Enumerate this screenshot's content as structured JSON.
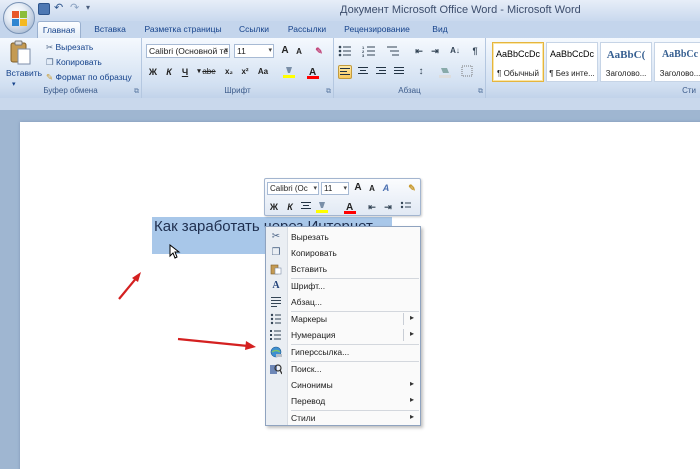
{
  "window": {
    "title": "Документ Microsoft Office Word - Microsoft Word"
  },
  "tabs": [
    "Главная",
    "Вставка",
    "Разметка страницы",
    "Ссылки",
    "Рассылки",
    "Рецензирование",
    "Вид"
  ],
  "ribbon": {
    "clipboard": {
      "paste": "Вставить",
      "cut": "Вырезать",
      "copy": "Копировать",
      "format_painter": "Формат по образцу",
      "label": "Буфер обмена"
    },
    "font": {
      "font_name": "Calibri (Основной те",
      "font_size": "11",
      "bold": "Ж",
      "italic": "К",
      "underline": "Ч",
      "strike": "abe",
      "subscript": "x₂",
      "superscript": "x²",
      "change_case": "Aa",
      "grow": "A",
      "shrink": "A",
      "label": "Шрифт"
    },
    "paragraph": {
      "label": "Абзац"
    },
    "styles": {
      "items": [
        {
          "sample": "AaBbCcDc",
          "name": "¶ Обычный"
        },
        {
          "sample": "AaBbCcDc",
          "name": "¶ Без инте..."
        },
        {
          "sample": "AaBbC(",
          "name": "Заголово..."
        },
        {
          "sample": "AaBbCc",
          "name": "Заголово..."
        }
      ],
      "label": "Сти"
    }
  },
  "document": {
    "selected_text": "Как заработать через Интернет"
  },
  "mini_toolbar": {
    "font_name": "Calibri (Ос",
    "font_size": "11",
    "bold": "Ж",
    "italic": "К"
  },
  "context_menu": {
    "items": [
      {
        "label": "Вырезать",
        "icon": "scissors-icon"
      },
      {
        "label": "Копировать",
        "icon": "copy-icon"
      },
      {
        "label": "Вставить",
        "icon": "paste-icon"
      },
      {
        "label": "Шрифт...",
        "icon": "font-icon"
      },
      {
        "label": "Абзац...",
        "icon": "paragraph-icon"
      },
      {
        "label": "Маркеры",
        "icon": "bullets-icon"
      },
      {
        "label": "Нумерация",
        "icon": "numbering-icon"
      },
      {
        "label": "Гиперссылка...",
        "icon": "hyperlink-icon"
      },
      {
        "label": "Поиск...",
        "icon": "research-icon"
      },
      {
        "label": "Синонимы",
        "icon": ""
      },
      {
        "label": "Перевод",
        "icon": ""
      },
      {
        "label": "Стили",
        "icon": ""
      }
    ]
  },
  "colors": {
    "selection": "#a8c7e9",
    "arrow": "#d42020",
    "highlight": "#ffff00",
    "font_color": "#ff0000"
  }
}
